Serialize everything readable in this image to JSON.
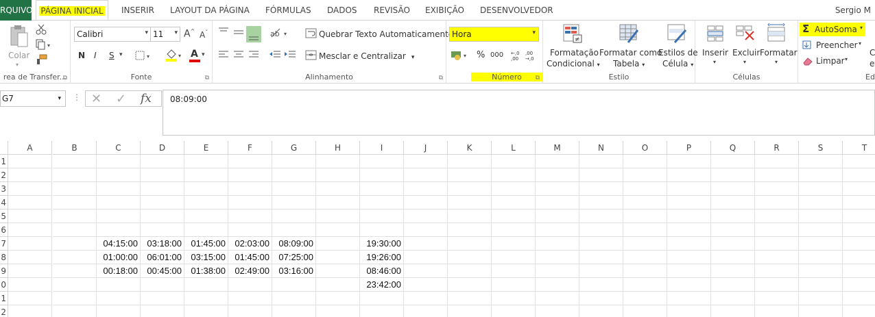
{
  "menu": {
    "tabs": [
      "RQUIVO",
      "PÁGINA INICIAL",
      "INSERIR",
      "LAYOUT DA PÁGINA",
      "FÓRMULAS",
      "DADOS",
      "REVISÃO",
      "EXIBIÇÃO",
      "DESENVOLVEDOR"
    ],
    "user": "Sergio M"
  },
  "ribbon": {
    "clipboard": {
      "paste_label": "Colar",
      "group_label": "rea de Transfer..."
    },
    "font": {
      "font_name": "Calibri",
      "font_size": "11",
      "bold": "N",
      "italic": "I",
      "underline": "S",
      "grow": "A",
      "shrink": "A",
      "color_letter": "A",
      "group_label": "Fonte"
    },
    "alignment": {
      "wrap_label": "Quebrar Texto Automaticamente",
      "merge_label": "Mesclar e Centralizar",
      "group_label": "Alinhamento"
    },
    "number": {
      "format": "Hora",
      "percent": "%",
      "thousands": "000",
      "group_label": "Número"
    },
    "styles": {
      "cond_line1": "Formatação",
      "cond_line2": "Condicional",
      "table_line1": "Formatar como",
      "table_line2": "Tabela",
      "cell_line1": "Estilos de",
      "cell_line2": "Célula",
      "group_label": "Estilo"
    },
    "cells": {
      "insert": "Inserir",
      "delete": "Excluir",
      "format": "Formatar",
      "group_label": "Células"
    },
    "editing": {
      "autosum": "AutoSoma",
      "fill": "Preencher",
      "clear": "Limpar",
      "group_label": "Ed",
      "extra": "C",
      "extra2": "e"
    }
  },
  "formula_bar": {
    "name_box": "G7",
    "cancel": "✕",
    "enter": "✓",
    "fx": "fx",
    "value": "08:09:00"
  },
  "sheet": {
    "columns": [
      "A",
      "B",
      "C",
      "D",
      "E",
      "F",
      "G",
      "H",
      "I",
      "J",
      "K",
      "L",
      "M",
      "N",
      "O",
      "P",
      "Q",
      "R",
      "S",
      "T"
    ],
    "row_labels": [
      "1",
      "2",
      "3",
      "4",
      "5",
      "6",
      "7",
      "8",
      "9",
      "0",
      "1",
      "2"
    ],
    "rows": {
      "r7": {
        "C": "04:15:00",
        "D": "03:18:00",
        "E": "01:45:00",
        "F": "02:03:00",
        "G": "08:09:00",
        "I": "19:30:00"
      },
      "r8": {
        "C": "01:00:00",
        "D": "06:01:00",
        "E": "03:15:00",
        "F": "01:45:00",
        "G": "07:25:00",
        "I": "19:26:00"
      },
      "r9": {
        "C": "00:18:00",
        "D": "00:45:00",
        "E": "01:38:00",
        "F": "02:49:00",
        "G": "03:16:00",
        "I": "08:46:00"
      },
      "r10": {
        "I": "23:42:00"
      }
    }
  },
  "colors": {
    "file_tab": "#217346",
    "highlight": "#ffff00",
    "font_color_bar": "#e00000",
    "fill_color_bar": "#ffff00"
  }
}
